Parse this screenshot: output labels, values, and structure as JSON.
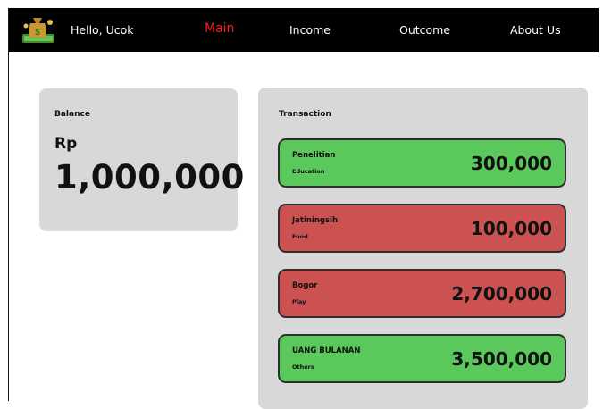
{
  "navbar": {
    "logo_icon": "money-bag-icon",
    "greeting": "Hello, Ucok",
    "items": [
      {
        "label": "Main",
        "active": true,
        "color": "#ff1a1a"
      },
      {
        "label": "Income",
        "active": false
      },
      {
        "label": "Outcome",
        "active": false
      },
      {
        "label": "About Us",
        "active": false
      }
    ]
  },
  "balance": {
    "label": "Balance",
    "currency": "Rp",
    "amount": "1,000,000"
  },
  "transactions": {
    "title": "Transaction",
    "items": [
      {
        "name": "Penelitian",
        "category": "Education",
        "amount": "300,000",
        "type": "income",
        "color": "#5ac85a"
      },
      {
        "name": "Jatiningsih",
        "category": "Food",
        "amount": "100,000",
        "type": "outcome",
        "color": "#cc5252"
      },
      {
        "name": "Bogor",
        "category": "Play",
        "amount": "2,700,000",
        "type": "outcome",
        "color": "#cc5252"
      },
      {
        "name": "UANG BULANAN",
        "category": "Others",
        "amount": "3,500,000",
        "type": "income",
        "color": "#5ac85a"
      }
    ]
  }
}
